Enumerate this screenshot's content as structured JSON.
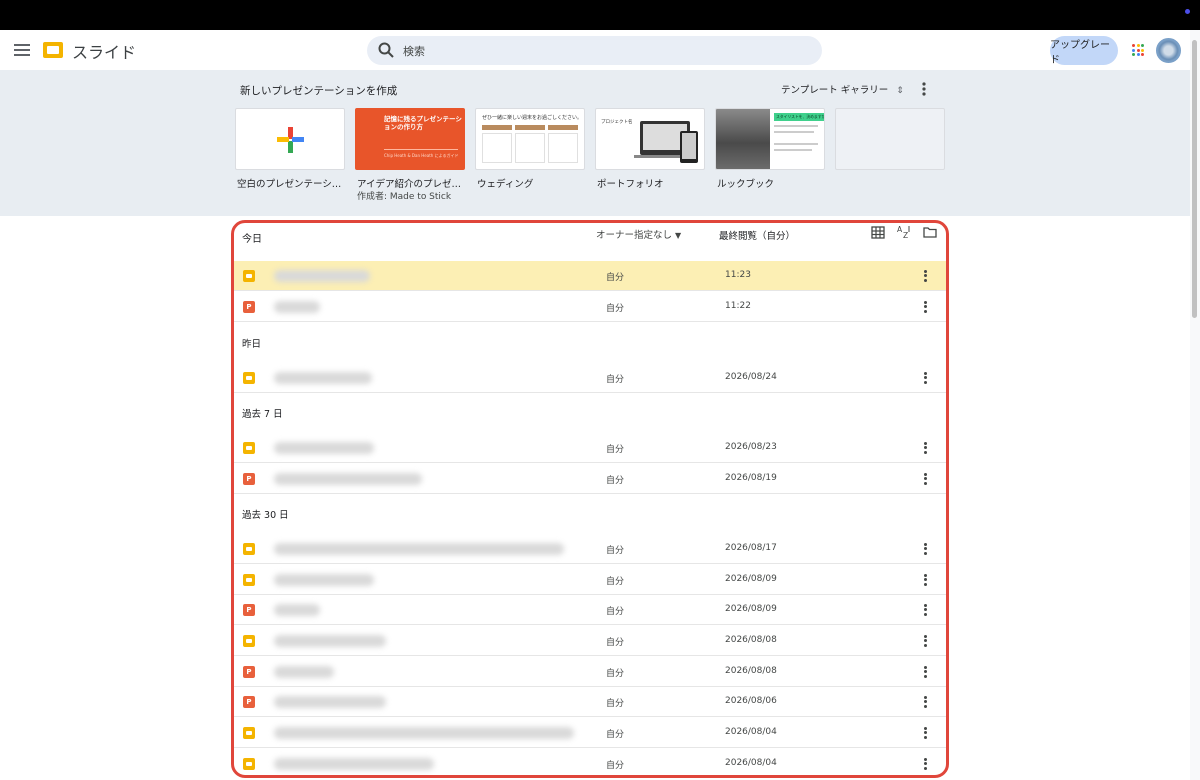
{
  "app": {
    "title": "スライド"
  },
  "search": {
    "placeholder": "検索"
  },
  "header": {
    "upgrade_label": "アップグレード"
  },
  "templates": {
    "heading": "新しいプレゼンテーションを作成",
    "gallery_label": "テンプレート ギャラリー",
    "gallery_icon": "unfold-icon",
    "items": [
      {
        "label": "空白のプレゼンテーシ…",
        "sub": ""
      },
      {
        "label": "アイデア紹介のプレゼ…",
        "sub": "作成者: Made to Stick",
        "thumb_title": "記憶に残るプレゼンテーションの作り方",
        "thumb_sub": "Chip Heath & Dan Heath によるガイド"
      },
      {
        "label": "ウェディング",
        "sub": "",
        "thumb_title": "ぜひ一緒に楽しい週末をお過ごしください。"
      },
      {
        "label": "ポートフォリオ",
        "sub": "",
        "thumb_title": "プロジェクト名"
      },
      {
        "label": "ルックブック",
        "sub": "",
        "thumb_title": "スタイリストを、決めますか"
      },
      {
        "label": "",
        "sub": ""
      }
    ]
  },
  "list": {
    "today_label": "今日",
    "owner_filter": "オーナー指定なし",
    "last_viewed": "最終閲覧（自分）",
    "sections": {
      "yesterday": "昨日",
      "past7": "過去 7 日",
      "past30": "過去 30 日"
    },
    "rows": [
      {
        "type": "slides",
        "owner": "自分",
        "date": "11:23"
      },
      {
        "type": "ppt",
        "owner": "自分",
        "date": "11:22"
      },
      {
        "type": "slides",
        "owner": "自分",
        "date": "2026/08/24"
      },
      {
        "type": "slides",
        "owner": "自分",
        "date": "2026/08/23"
      },
      {
        "type": "ppt",
        "owner": "自分",
        "date": "2026/08/19"
      },
      {
        "type": "slides",
        "owner": "自分",
        "date": "2026/08/17"
      },
      {
        "type": "slides",
        "owner": "自分",
        "date": "2026/08/09"
      },
      {
        "type": "ppt",
        "owner": "自分",
        "date": "2026/08/09"
      },
      {
        "type": "slides",
        "owner": "自分",
        "date": "2026/08/08"
      },
      {
        "type": "ppt",
        "owner": "自分",
        "date": "2026/08/08"
      },
      {
        "type": "ppt",
        "owner": "自分",
        "date": "2026/08/06"
      },
      {
        "type": "slides",
        "owner": "自分",
        "date": "2026/08/04"
      },
      {
        "type": "slides",
        "owner": "自分",
        "date": "2026/08/04"
      }
    ]
  },
  "colors": {
    "accent_highlight": "#e0463b",
    "selected_row": "#fcefb4",
    "slides_yellow": "#f4b400",
    "ppt_orange": "#e8603c"
  }
}
